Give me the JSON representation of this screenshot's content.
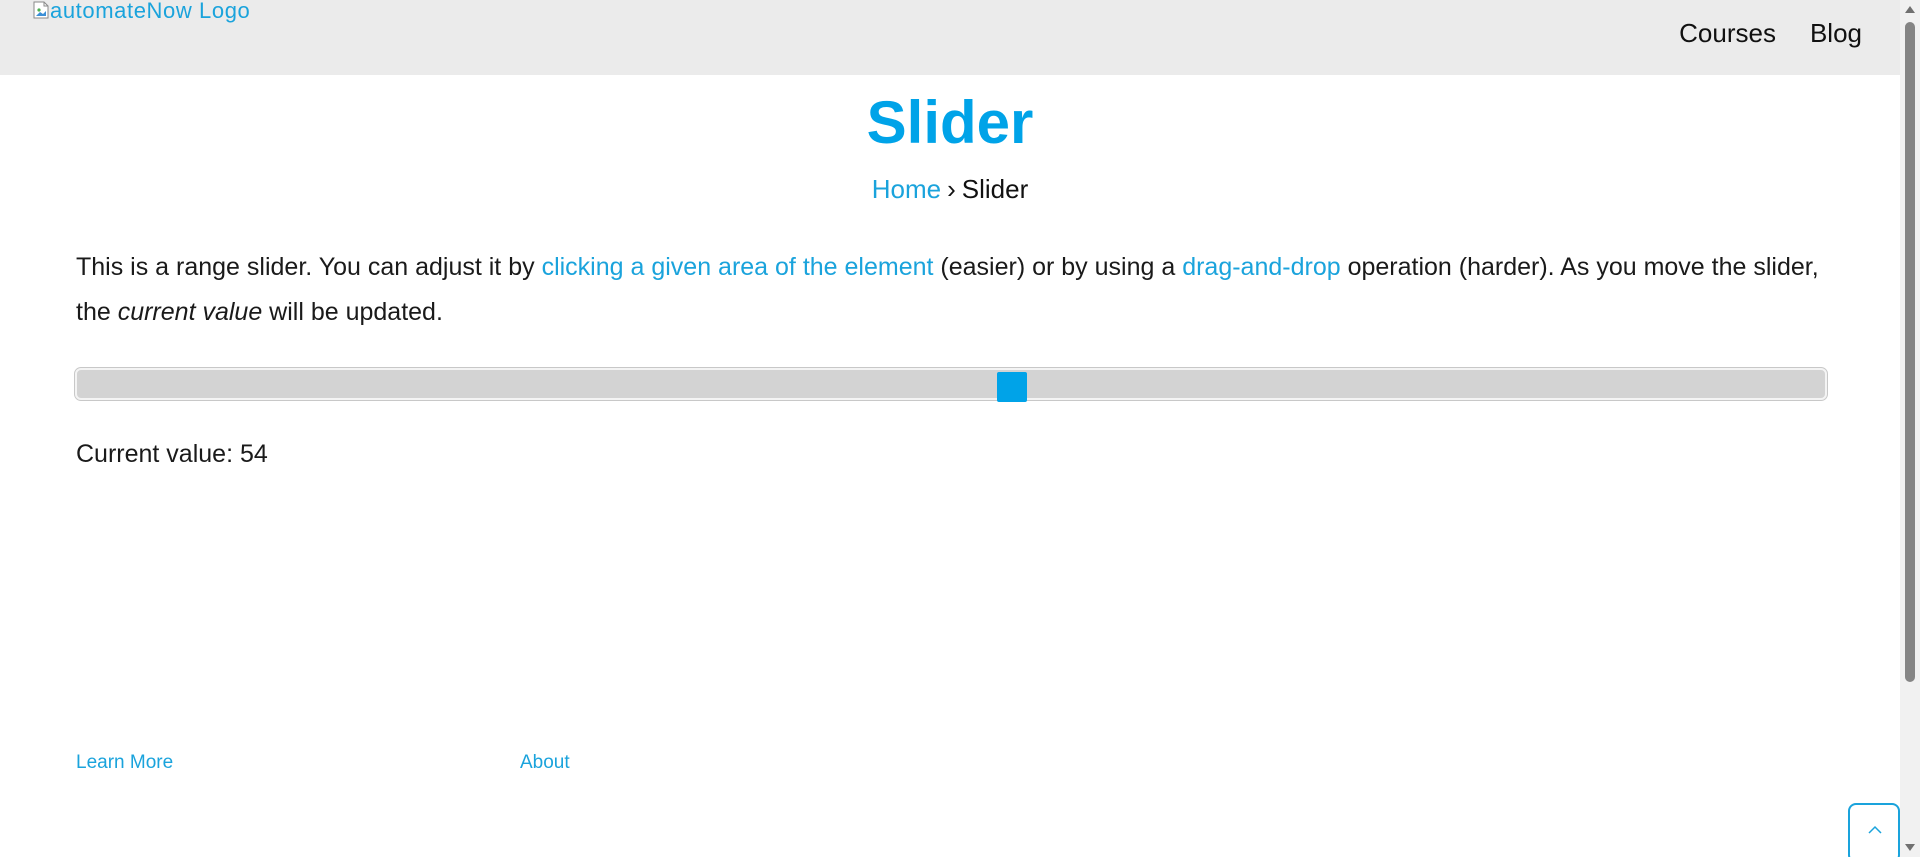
{
  "header": {
    "logo_alt": "automateNow Logo",
    "nav": [
      {
        "label": "Courses"
      },
      {
        "label": "Blog"
      }
    ]
  },
  "page": {
    "title": "Slider",
    "breadcrumb": {
      "home": "Home",
      "separator": "›",
      "current": "Slider"
    }
  },
  "intro": {
    "part1": "This is a range slider. You can adjust it by ",
    "link1": "clicking a given area of the element",
    "part2": " (easier) or by using a ",
    "link2": "drag-and-drop",
    "part3": " operation (harder). As you move the slider, the ",
    "em": "current value",
    "part4": " will be updated."
  },
  "slider": {
    "min": 1,
    "max": 100,
    "value": 54,
    "thumb_color": "#00a3e8",
    "track_color": "#d3d3d3"
  },
  "current_value": {
    "label": "Current value: ",
    "value": "54"
  },
  "footer": {
    "learn_more": "Learn More",
    "about": "About"
  },
  "colors": {
    "accent": "#00a3e8",
    "link": "#1aa3dc",
    "header_bg": "#ebebeb"
  },
  "icons": {
    "logo_placeholder": "broken-image-icon",
    "back_to_top": "chevron-up-icon"
  }
}
